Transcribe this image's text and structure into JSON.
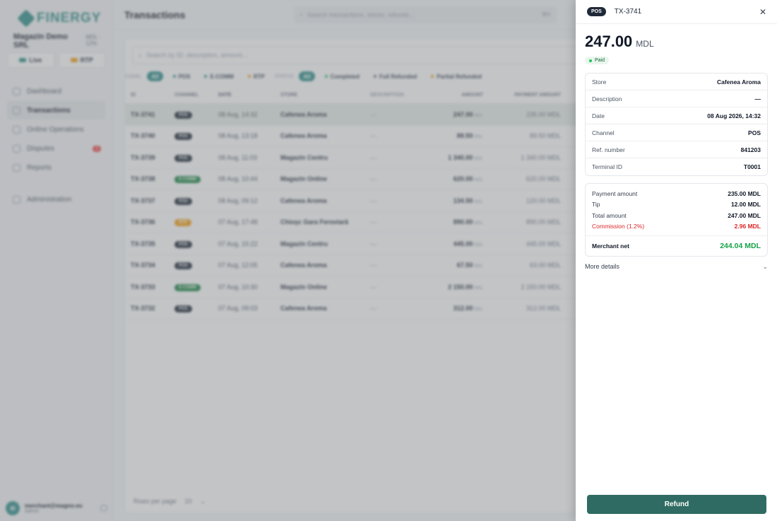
{
  "sidebar": {
    "brand": "FINERGY",
    "merchant_name": "Magazin Demo SRL",
    "merchant_meta": "MDL · 12%",
    "modes": [
      "Live",
      "RTP"
    ],
    "nav": [
      {
        "label": "Dashboard"
      },
      {
        "label": "Transactions"
      },
      {
        "label": "Online Operations"
      },
      {
        "label": "Disputes",
        "badge": "2"
      },
      {
        "label": "Reports"
      },
      {
        "label": "Administration"
      }
    ],
    "user_initials": "M",
    "user_email": "merchant@magno.eu",
    "user_role": "Admin"
  },
  "page": {
    "title": "Transactions",
    "global_search_placeholder": "Search transactions, stores, refunds...",
    "global_search_kbd": "⌘K",
    "table_search_placeholder": "Search by ID, description, amount..."
  },
  "filters": {
    "channel_label": "CANAL",
    "channel": [
      "All",
      "POS",
      "E-COMM",
      "RTP"
    ],
    "status_label": "STATUS",
    "status": [
      "All",
      "Completed",
      "Full Refunded",
      "Partial Refunded"
    ]
  },
  "table": {
    "columns": [
      "ID",
      "CHANNEL",
      "DATE",
      "STORE",
      "DESCRIPTION",
      "AMOUNT",
      "PAYMENT AMOUNT"
    ],
    "currency": "MDL",
    "rows": [
      {
        "id": "TX-3741",
        "channel": "POS",
        "date": "08 Aug, 14:32",
        "store": "Cafenea Aroma",
        "desc": "—",
        "amount": "247.00",
        "payment": "235.00 MDL"
      },
      {
        "id": "TX-3740",
        "channel": "POS",
        "date": "08 Aug, 13:18",
        "store": "Cafenea Aroma",
        "desc": "—",
        "amount": "89.50",
        "payment": "89.50 MDL"
      },
      {
        "id": "TX-3739",
        "channel": "POS",
        "date": "08 Aug, 11:03",
        "store": "Magazin Centru",
        "desc": "—",
        "amount": "1 340.00",
        "payment": "1 340.00 MDL"
      },
      {
        "id": "TX-3738",
        "channel": "E-COMM",
        "date": "08 Aug, 10:44",
        "store": "Magazin Online",
        "desc": "—",
        "amount": "620.00",
        "payment": "620.00 MDL"
      },
      {
        "id": "TX-3737",
        "channel": "POS",
        "date": "08 Aug, 09:12",
        "store": "Cafenea Aroma",
        "desc": "—",
        "amount": "134.50",
        "payment": "120.00 MDL"
      },
      {
        "id": "TX-3736",
        "channel": "RTP",
        "date": "07 Aug, 17:48",
        "store": "Chioşc Gara Feroviară",
        "desc": "—",
        "amount": "890.00",
        "payment": "890.00 MDL"
      },
      {
        "id": "TX-3735",
        "channel": "POS",
        "date": "07 Aug, 15:22",
        "store": "Magazin Centru",
        "desc": "—",
        "amount": "445.00",
        "payment": "445.00 MDL"
      },
      {
        "id": "TX-3734",
        "channel": "POS",
        "date": "07 Aug, 12:05",
        "store": "Cafenea Aroma",
        "desc": "—",
        "amount": "67.50",
        "payment": "63.00 MDL"
      },
      {
        "id": "TX-3733",
        "channel": "E-COMM",
        "date": "07 Aug, 10:30",
        "store": "Magazin Online",
        "desc": "—",
        "amount": "2 150.00",
        "payment": "2 150.00 MDL"
      },
      {
        "id": "TX-3732",
        "channel": "POS",
        "date": "07 Aug, 09:03",
        "store": "Cafenea Aroma",
        "desc": "—",
        "amount": "312.00",
        "payment": "312.00 MDL"
      }
    ],
    "rows_per_page_label": "Rows per page",
    "rows_per_page": "10"
  },
  "drawer": {
    "channel_chip": "POS",
    "tx_id": "TX-3741",
    "amount": "247.00",
    "currency": "MDL",
    "status": "Paid",
    "details": [
      {
        "label": "Store",
        "value": "Cafenea Aroma"
      },
      {
        "label": "Description",
        "value": "—"
      },
      {
        "label": "Date",
        "value": "08 Aug 2026, 14:32"
      },
      {
        "label": "Channel",
        "value": "POS"
      },
      {
        "label": "Ref. number",
        "value": "841203"
      },
      {
        "label": "Terminal ID",
        "value": "T0001"
      }
    ],
    "payment": {
      "payment_amount_label": "Payment amount",
      "payment_amount": "235.00 MDL",
      "tip_label": "Tip",
      "tip": "12.00 MDL",
      "total_label": "Total amount",
      "total": "247.00 MDL",
      "commission_label": "Commission (1.2%)",
      "commission": "2.96 MDL",
      "net_label": "Merchant net",
      "net": "244.04 MDL"
    },
    "more_details": "More details",
    "refund_label": "Refund"
  }
}
